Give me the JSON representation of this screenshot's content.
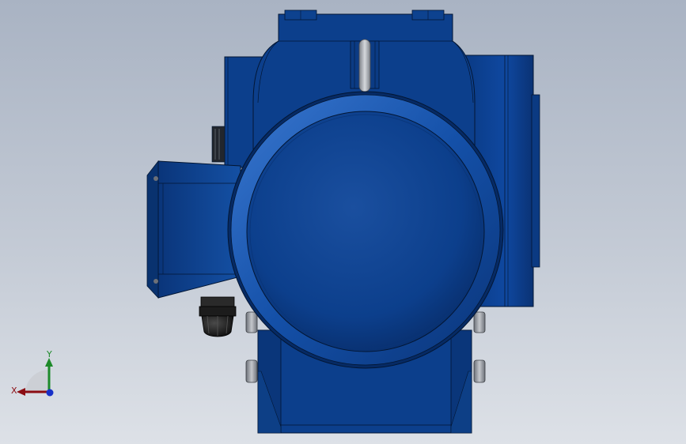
{
  "viewport": {
    "background_top": "#a9b3c3",
    "background_bottom": "#dde1e7"
  },
  "model": {
    "body_color": "#0c3f8c",
    "body_dark": "#06245a",
    "body_light": "#2a63b8",
    "cable_gland_color": "#1a1a1a",
    "bolt_color": "#9a9ea6",
    "lifting_eye_color": "#a8acb3"
  },
  "triad": {
    "x_label": "X",
    "y_label": "Y",
    "x_color": "#8b0d13",
    "y_color": "#1d8a2a",
    "z_color": "#1730c8"
  }
}
